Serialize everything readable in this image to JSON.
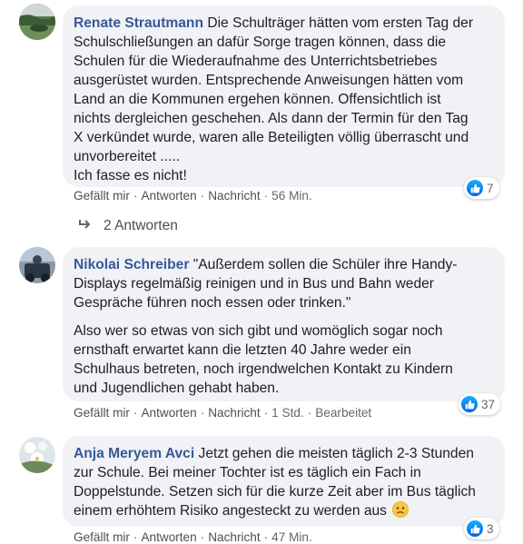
{
  "colors": {
    "author": "#385898",
    "bubble": "#f0f2f5",
    "meta": "#606770",
    "like_blue": "#1877f2"
  },
  "comments": [
    {
      "author": "Renate Strautmann",
      "text_lines": [
        "Die Schulträger hätten vom ersten Tag der",
        "Schulschließungen an dafür Sorge tragen können, dass die",
        "Schulen für die Wiederaufnahme des Unterrichtsbetriebes",
        "ausgerüstet wurden. Entsprechende Anweisungen hätten vom",
        "Land an die Kommunen ergehen können. Offensichtlich ist",
        "nichts dergleichen geschehen. Als dann der Termin für den Tag",
        "X verkündet wurde, waren alle Beteiligten völlig überrascht und",
        "unvorbereitet .....",
        "Ich fasse es nicht!"
      ],
      "actions": [
        "Gefällt mir",
        "Antworten",
        "Nachricht"
      ],
      "time": "56 Min.",
      "reaction_icon": "like-icon",
      "reaction_count": "7",
      "replies_label": "2 Antworten"
    },
    {
      "author": "Nikolai Schreiber",
      "paragraph1_lines": [
        "\"Außerdem sollen die Schüler ihre Handy-",
        "Displays regelmäßig reinigen und in Bus und Bahn weder",
        "Gespräche führen noch essen oder trinken.\""
      ],
      "paragraph2_lines": [
        "Also wer so etwas von sich gibt und womöglich sogar noch",
        "ernsthaft erwartet kann die letzten 40 Jahre weder ein",
        "Schulhaus betreten, noch irgendwelchen Kontakt zu Kindern",
        "und Jugendlichen gehabt haben."
      ],
      "actions": [
        "Gefällt mir",
        "Antworten",
        "Nachricht"
      ],
      "time": "1 Std.",
      "edited": "Bearbeitet",
      "reaction_icon": "like-icon",
      "reaction_count": "37"
    },
    {
      "author": "Anja Meryem Avci",
      "text_lines": [
        "Jetzt gehen die meisten täglich 2-3 Stunden",
        "zur Schule. Bei meiner Tochter ist es täglich ein Fach in",
        "Doppelstunde. Setzen sich für die kurze Zeit aber im Bus täglich",
        "einem erhöhtem Risiko angesteckt zu werden aus"
      ],
      "emoji": "worried-face-emoji",
      "actions": [
        "Gefällt mir",
        "Antworten",
        "Nachricht"
      ],
      "time": "47 Min.",
      "reaction_icon": "like-icon",
      "reaction_count": "3"
    }
  ]
}
